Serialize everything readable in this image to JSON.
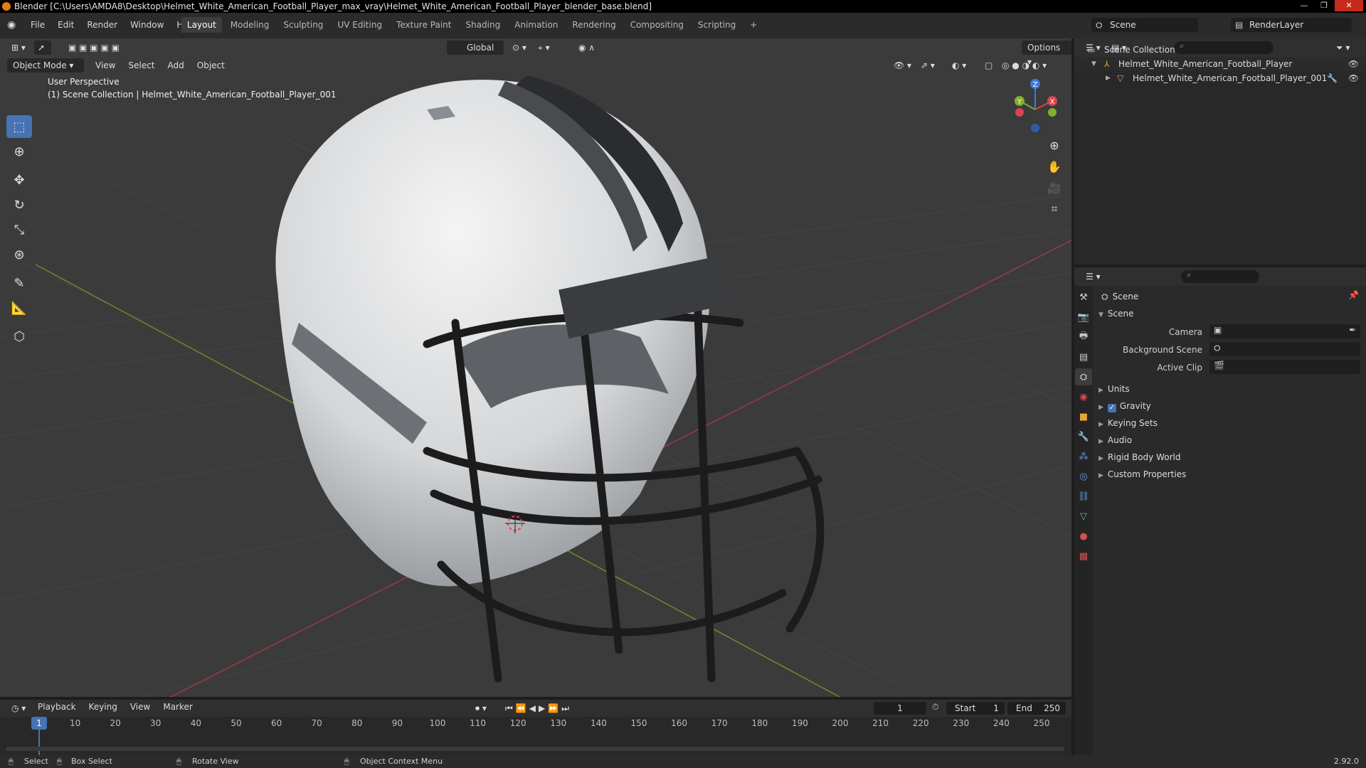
{
  "window": {
    "title": "Blender [C:\\Users\\AMDA8\\Desktop\\Helmet_White_American_Football_Player_max_vray\\Helmet_White_American_Football_Player_blender_base.blend]",
    "controls": [
      "—",
      "❐",
      "✕"
    ]
  },
  "menu": [
    "File",
    "Edit",
    "Render",
    "Window",
    "Help"
  ],
  "workspaces": [
    "Layout",
    "Modeling",
    "Sculpting",
    "UV Editing",
    "Texture Paint",
    "Shading",
    "Animation",
    "Rendering",
    "Compositing",
    "Scripting",
    "+"
  ],
  "scene_name": "Scene",
  "view_layer": "RenderLayer",
  "viewport": {
    "transform_orientation": "Global",
    "options_label": "Options",
    "mode": "Object Mode",
    "header_menu": [
      "View",
      "Select",
      "Add",
      "Object"
    ],
    "perspective": "User Perspective",
    "collection_info": "(1) Scene Collection | Helmet_White_American_Football_Player_001",
    "gizmo": {
      "x": "X",
      "y": "Y",
      "z": "Z"
    }
  },
  "outliner": {
    "root": "Scene Collection",
    "items": [
      {
        "label": "Helmet_White_American_Football_Player"
      },
      {
        "label": "Helmet_White_American_Football_Player_001"
      }
    ]
  },
  "properties": {
    "context": "Scene",
    "panel": "Scene",
    "fields": [
      {
        "label": "Camera"
      },
      {
        "label": "Background Scene"
      },
      {
        "label": "Active Clip"
      }
    ],
    "sections": [
      {
        "label": "Units",
        "checkbox": false
      },
      {
        "label": "Gravity",
        "checkbox": true
      },
      {
        "label": "Keying Sets",
        "checkbox": false
      },
      {
        "label": "Audio",
        "checkbox": false
      },
      {
        "label": "Rigid Body World",
        "checkbox": false
      },
      {
        "label": "Custom Properties",
        "checkbox": false
      }
    ]
  },
  "timeline": {
    "menu": [
      "Playback",
      "Keying",
      "View",
      "Marker"
    ],
    "current_frame": "1",
    "start_label": "Start",
    "start": "1",
    "end_label": "End",
    "end": "250",
    "ticks": [
      "1",
      "10",
      "20",
      "30",
      "40",
      "50",
      "60",
      "70",
      "80",
      "90",
      "100",
      "110",
      "120",
      "130",
      "140",
      "150",
      "160",
      "170",
      "180",
      "190",
      "200",
      "210",
      "220",
      "230",
      "240",
      "250"
    ]
  },
  "status": {
    "select": "Select",
    "box_select": "Box Select",
    "rotate_view": "Rotate View",
    "context_menu": "Object Context Menu",
    "version": "2.92.0"
  },
  "colors": {
    "accent": "#4772b3",
    "axis_x": "#d8454f",
    "axis_y": "#82b02a",
    "axis_z": "#3d7be0"
  }
}
